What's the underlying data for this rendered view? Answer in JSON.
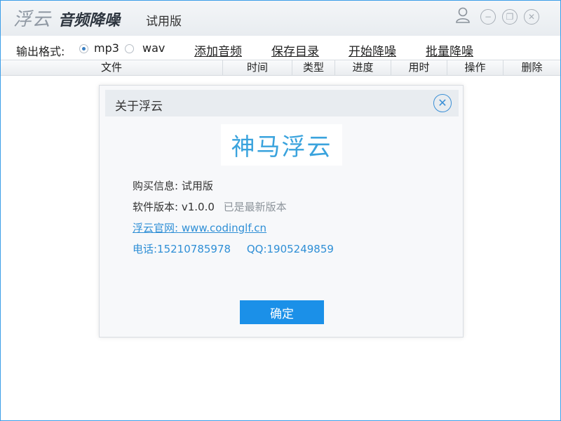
{
  "app": {
    "logo_text": "浮云",
    "name": "音频降噪",
    "edition": "试用版"
  },
  "window_controls": {
    "user": "user-icon",
    "minimize": "−",
    "maximize": "❐",
    "close": "✕"
  },
  "toolbar": {
    "format_label": "输出格式:",
    "formats": [
      {
        "label": "mp3",
        "checked": true
      },
      {
        "label": "wav",
        "checked": false
      }
    ],
    "actions": [
      "添加音频",
      "保存目录",
      "开始降噪",
      "批量降噪"
    ]
  },
  "table": {
    "columns": [
      "文件",
      "时间",
      "类型",
      "进度",
      "用时",
      "操作",
      "删除"
    ],
    "rows": []
  },
  "dialog": {
    "title": "关于浮云",
    "close": "✕",
    "logo_text": "神马浮云",
    "purchase_label": "购买信息:",
    "purchase_value": "试用版",
    "version_label": "软件版本:",
    "version_value": "v1.0.0",
    "version_status": "已是最新版本",
    "website_label": "浮云官网:",
    "website_value": "www.codinglf.cn",
    "phone": "电话:15210785978",
    "qq": "QQ:1905249859",
    "ok_label": "确定"
  },
  "colors": {
    "accent": "#1b90e8",
    "link": "#2f8fd6",
    "border": "#3c9ee8"
  }
}
